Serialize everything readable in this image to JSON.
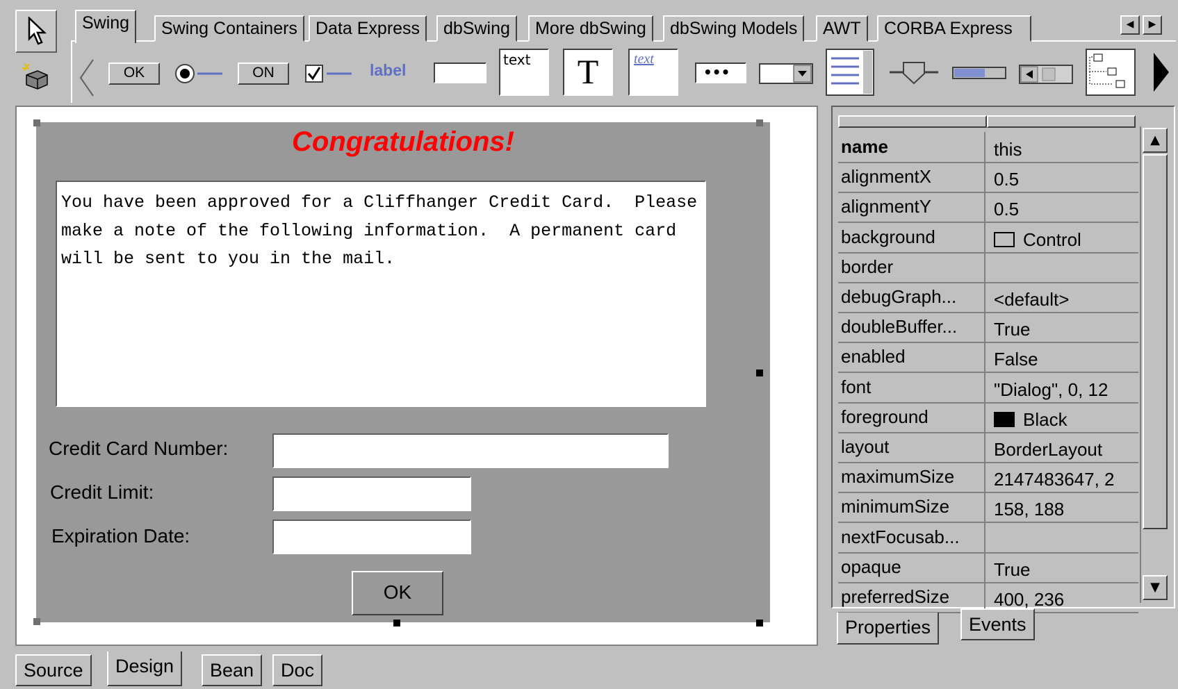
{
  "palette": {
    "tabs": [
      "Swing",
      "Swing Containers",
      "Data Express",
      "dbSwing",
      "More dbSwing",
      "dbSwing Models",
      "AWT",
      "CORBA Express"
    ],
    "active_tab": "Swing",
    "items": {
      "button_label": "OK",
      "toggle_label": "ON",
      "label_text": "label",
      "textarea_text": "text",
      "textpane_glyph": "T",
      "editorpane_text": "text",
      "password_glyph": "•••"
    }
  },
  "design": {
    "title": "Congratulations!",
    "message": "You have been approved for a Cliffhanger Credit Card.  Please make a note of the following information.  A permanent card will be sent to you in the mail.",
    "fields": [
      {
        "label": "Credit Card Number:",
        "value": ""
      },
      {
        "label": "Credit Limit:",
        "value": ""
      },
      {
        "label": "Expiration Date:",
        "value": ""
      }
    ],
    "ok_label": "OK"
  },
  "inspector": {
    "properties": [
      {
        "name": "name",
        "value": "this",
        "bold": true
      },
      {
        "name": "alignmentX",
        "value": "0.5"
      },
      {
        "name": "alignmentY",
        "value": "0.5"
      },
      {
        "name": "background",
        "value": "Control",
        "swatch": "#c0c0c0"
      },
      {
        "name": "border",
        "value": ""
      },
      {
        "name": "debugGraph...",
        "value": "<default>"
      },
      {
        "name": "doubleBuffer...",
        "value": "True"
      },
      {
        "name": "enabled",
        "value": "False"
      },
      {
        "name": "font",
        "value": "\"Dialog\", 0, 12"
      },
      {
        "name": "foreground",
        "value": "Black",
        "swatch": "#000000"
      },
      {
        "name": "layout",
        "value": "BorderLayout"
      },
      {
        "name": "maximumSize",
        "value": "2147483647, 2"
      },
      {
        "name": "minimumSize",
        "value": "158, 188"
      },
      {
        "name": "nextFocusab...",
        "value": ""
      },
      {
        "name": "opaque",
        "value": "True"
      },
      {
        "name": "preferredSize",
        "value": "400, 236"
      }
    ],
    "tabs": [
      "Properties",
      "Events"
    ],
    "active_tab": "Properties"
  },
  "bottom_tabs": {
    "tabs": [
      "Source",
      "Design",
      "Bean",
      "Doc"
    ],
    "active": "Design"
  }
}
